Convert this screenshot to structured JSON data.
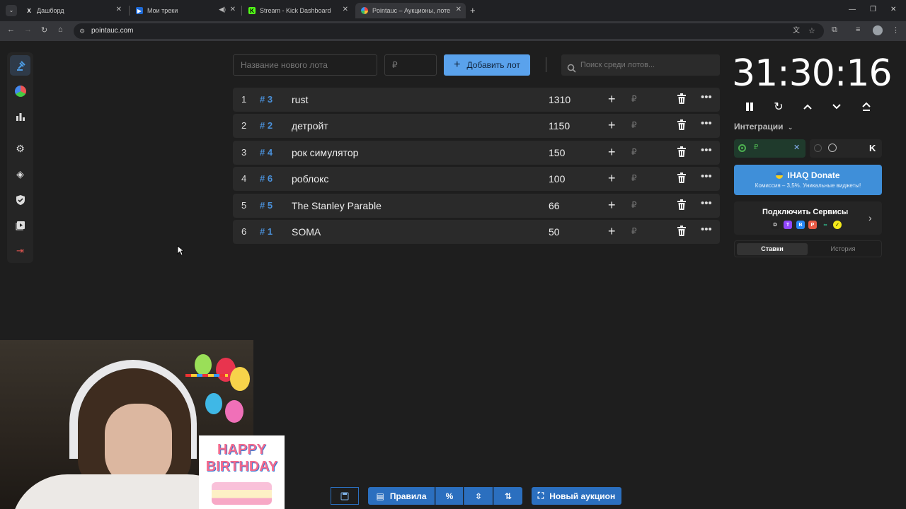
{
  "browser": {
    "tabs": [
      {
        "title": "Дашборд"
      },
      {
        "title": "Мои треки"
      },
      {
        "title": "Stream - Kick Dashboard"
      },
      {
        "title": "Pointauc – Аукционы, лотерея"
      }
    ],
    "url": "pointauc.com"
  },
  "toolbar": {
    "new_lot_placeholder": "Название нового лота",
    "amount_placeholder": "₽",
    "add_lot_label": "Добавить лот",
    "search_placeholder": "Поиск среди лотов..."
  },
  "lots": [
    {
      "index": "1",
      "id": "# 3",
      "name": "rust",
      "amount": "1310"
    },
    {
      "index": "2",
      "id": "# 2",
      "name": "детройт",
      "amount": "1150"
    },
    {
      "index": "3",
      "id": "# 4",
      "name": "рок симулятор",
      "amount": "150"
    },
    {
      "index": "4",
      "id": "# 6",
      "name": "роблокс",
      "amount": "100"
    },
    {
      "index": "5",
      "id": "# 5",
      "name": "The Stanley Parable",
      "amount": "66"
    },
    {
      "index": "6",
      "id": "# 1",
      "name": "SOMA",
      "amount": "50"
    }
  ],
  "lot_currency": "₽",
  "timer": {
    "value": "31:30:16"
  },
  "integrations": {
    "title": "Интеграции",
    "currency": "₽",
    "ihaq_title": "IHAQ Donate",
    "ihaq_sub": "Комиссия – 3,5%. Уникальные виджеты!",
    "connect_title": "Подключить Сервисы"
  },
  "bet_tabs": {
    "bets": "Ставки",
    "history": "История"
  },
  "bottom": {
    "rules_label": "Правила",
    "percent_label": "%",
    "new_auction_label": "Новый аукцион"
  },
  "overlay": {
    "birthday_text": "HAPPY BIRTHDAY"
  },
  "colors": {
    "accent": "#5aa2ec",
    "bg": "#1e1e1e",
    "row": "#2a2a2a"
  }
}
